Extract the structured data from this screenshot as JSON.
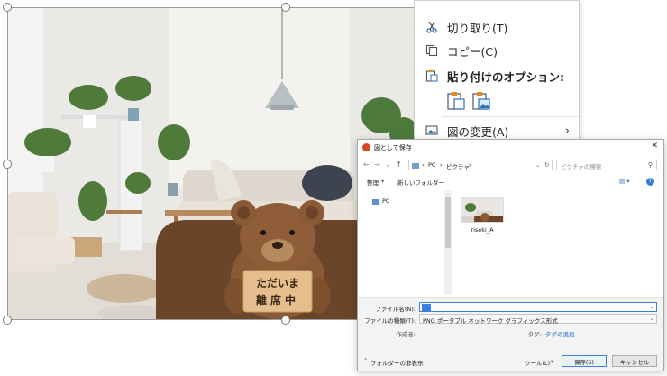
{
  "slide": {
    "sign_line1": "ただいま",
    "sign_line2": "離席中"
  },
  "context_menu": {
    "items": [
      {
        "label": "切り取り(T)",
        "icon": "scissors-icon"
      },
      {
        "label": "コピー(C)",
        "icon": "copy-icon"
      },
      {
        "label": "貼り付けのオプション:",
        "icon": "paste-icon"
      },
      {
        "label": "図の変更(A)",
        "icon": "change-picture-icon"
      }
    ]
  },
  "dialog": {
    "title": "図として保存",
    "close": "✕",
    "address": {
      "crumb1": "PC",
      "crumb2": "ピクチャ",
      "search_placeholder": "ピクチャの検索"
    },
    "toolbar": {
      "organize": "整理",
      "new_folder": "新しいフォルダー"
    },
    "nav": {
      "pc_label": "PC"
    },
    "file": {
      "name": "riseki_A"
    },
    "filename_label": "ファイル名(N):",
    "filename_value": "",
    "filetype_label": "ファイルの種類(T):",
    "filetype_value": "PNG ポータブル ネットワーク グラフィックス形式",
    "author_label": "作成者:",
    "tag_label": "タグ:",
    "tag_link": "タグの追加",
    "hide_folders": "フォルダーの非表示",
    "tools_button": "ツール(L)",
    "save_button": "保存(S)",
    "cancel_button": "キャンセル"
  },
  "colors": {
    "accent": "#3c7fd6",
    "link": "#1a65c8",
    "menu_icon_blue": "#2f6fb5",
    "menu_icon_orange": "#e08a1e"
  }
}
